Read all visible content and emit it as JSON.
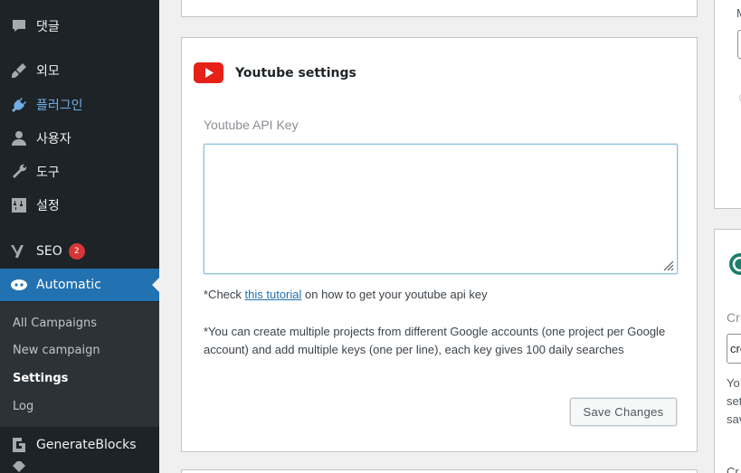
{
  "sidebar": {
    "items": [
      {
        "label": "댓글",
        "icon": "comment-icon"
      },
      {
        "label": "외모",
        "icon": "paintbrush-icon"
      },
      {
        "label": "플러그인",
        "icon": "plugin-icon"
      },
      {
        "label": "사용자",
        "icon": "user-icon"
      },
      {
        "label": "도구",
        "icon": "wrench-icon"
      },
      {
        "label": "설정",
        "icon": "settings-sliders-icon"
      },
      {
        "label": "SEO",
        "icon": "yoast-icon",
        "badge": "2"
      },
      {
        "label": "Automatic",
        "icon": "automatic-icon"
      },
      {
        "label": "GenerateBlocks",
        "icon": "generateblocks-icon"
      }
    ],
    "submenu": [
      {
        "label": "All Campaigns"
      },
      {
        "label": "New campaign"
      },
      {
        "label": "Settings"
      },
      {
        "label": "Log"
      }
    ]
  },
  "youtube": {
    "title": "Youtube settings",
    "api_label": "Youtube API Key",
    "api_value": "",
    "help1_prefix": "*Check ",
    "help1_link": "this tutorial",
    "help1_suffix": " on how to get your youtube api key",
    "help2": "*You can create multiple projects from different Google accounts (one project per Google account) and add multiple keys (one per line), each key gives 100 daily searches",
    "save_label": "Save Changes"
  },
  "side_panel": {
    "stub_m": "M",
    "stub_cr1": "Cr",
    "stub_cro": "cro",
    "stub_yo": "Yo",
    "stub_set": "set",
    "stub_sav": "sav",
    "stub_cr2": "Cr"
  },
  "colors": {
    "sidebar_bg": "#1d2327",
    "accent": "#2271b1",
    "highlight": "#72aee6",
    "badge": "#d63638",
    "youtube_red": "#e62117"
  }
}
